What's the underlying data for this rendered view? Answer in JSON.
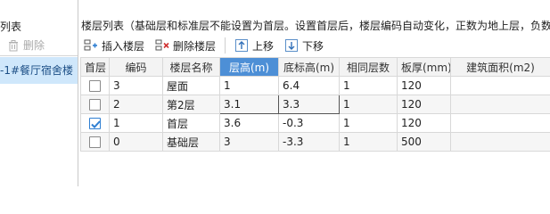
{
  "left": {
    "title": "列表",
    "delete_label": "删除",
    "item_label": "-1#餐厅宿舍楼（"
  },
  "right": {
    "title": "楼层列表（基础层和标准层不能设置为首层。设置首层后，楼层编码自动变化，正数为地上层，负数",
    "toolbar": {
      "insert_label": "插入楼层",
      "delete_label": "删除楼层",
      "up_label": "上移",
      "down_label": "下移"
    },
    "grid": {
      "columns": [
        "首层",
        "编码",
        "楼层名称",
        "层高(m)",
        "底标高(m)",
        "相同层数",
        "板厚(mm)",
        "建筑面积(m2)"
      ],
      "rows": [
        {
          "first": false,
          "code": "3",
          "name": "屋面",
          "height": "1",
          "bottom": "6.4",
          "same": "1",
          "slab": "120",
          "area": ""
        },
        {
          "first": false,
          "code": "2",
          "name": "第2层",
          "height": "3.1",
          "bottom": "3.3",
          "same": "1",
          "slab": "120",
          "area": ""
        },
        {
          "first": true,
          "code": "1",
          "name": "首层",
          "height": "3.6",
          "bottom": "-0.3",
          "same": "1",
          "slab": "120",
          "area": ""
        },
        {
          "first": false,
          "code": "0",
          "name": "基础层",
          "height": "3",
          "bottom": "-3.3",
          "same": "1",
          "slab": "500",
          "area": ""
        }
      ]
    }
  },
  "colors": {
    "header_highlight": "#4d8fd6",
    "selected_item": "#cfe7fb",
    "check": "#2f7fd2"
  }
}
